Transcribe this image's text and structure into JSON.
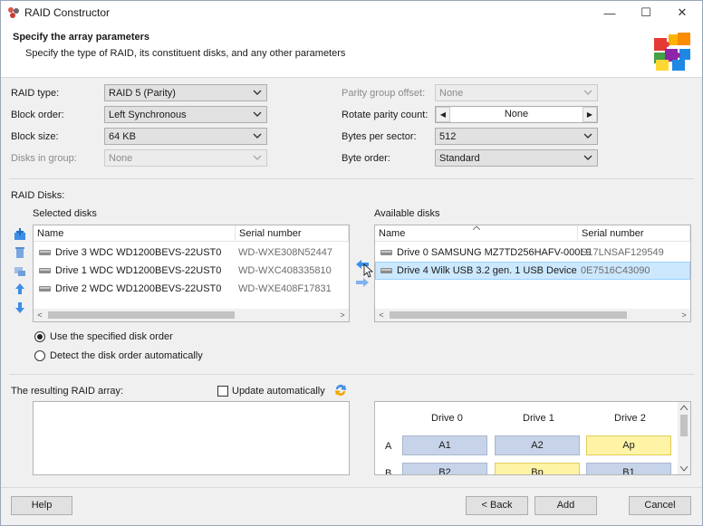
{
  "window": {
    "title": "RAID Constructor",
    "minimize": "—",
    "maximize": "☐",
    "close": "✕"
  },
  "header": {
    "title": "Specify the array parameters",
    "subtitle": "Specify the type of RAID, its constituent disks, and any other parameters"
  },
  "params": {
    "raid_type": {
      "label": "RAID type:",
      "value": "RAID 5 (Parity)"
    },
    "block_order": {
      "label": "Block order:",
      "value": "Left Synchronous"
    },
    "block_size": {
      "label": "Block size:",
      "value": "64 KB"
    },
    "disks_in_group": {
      "label": "Disks in group:",
      "value": "None"
    },
    "parity_group_offset": {
      "label": "Parity group offset:",
      "value": "None"
    },
    "rotate_parity_count": {
      "label": "Rotate parity count:",
      "value": "None"
    },
    "bytes_per_sector": {
      "label": "Bytes per sector:",
      "value": "512"
    },
    "byte_order": {
      "label": "Byte order:",
      "value": "Standard"
    }
  },
  "disks": {
    "section_label": "RAID Disks:",
    "selected_label": "Selected disks",
    "available_label": "Available disks",
    "columns": {
      "name": "Name",
      "serial": "Serial number"
    },
    "selected": [
      {
        "name": "Drive 3 WDC WD1200BEVS-22UST0",
        "serial": "WD-WXE308N52447"
      },
      {
        "name": "Drive 1 WDC WD1200BEVS-22UST0",
        "serial": "WD-WXC408335810"
      },
      {
        "name": "Drive 2 WDC WD1200BEVS-22UST0",
        "serial": "WD-WXE408F17831"
      }
    ],
    "available": [
      {
        "name": "Drive 0 SAMSUNG MZ7TD256HAFV-000L9",
        "serial": "S17LNSAF129549"
      },
      {
        "name": "Drive 4 Wilk USB 3.2 gen. 1 USB Device",
        "serial": "0E7516C43090"
      }
    ]
  },
  "order": {
    "use_specified": "Use the specified disk order",
    "detect_auto": "Detect the disk order automatically"
  },
  "result": {
    "label": "The resulting RAID array:",
    "update_auto": "Update automatically"
  },
  "layout_grid": {
    "drives": [
      "Drive 0",
      "Drive 1",
      "Drive 2"
    ],
    "rows": [
      {
        "label": "A",
        "cells": [
          "A1",
          "A2",
          "Ap"
        ]
      },
      {
        "label": "B",
        "cells": [
          "B2",
          "Bp",
          "B1"
        ]
      }
    ]
  },
  "buttons": {
    "help": "Help",
    "back": "< Back",
    "add": "Add",
    "cancel": "Cancel"
  },
  "colors": {
    "data_block": "#c7d3e8",
    "parity_block": "#fff3a6",
    "selection": "#cce8ff",
    "arrow_blue": "#3c8ee6"
  }
}
